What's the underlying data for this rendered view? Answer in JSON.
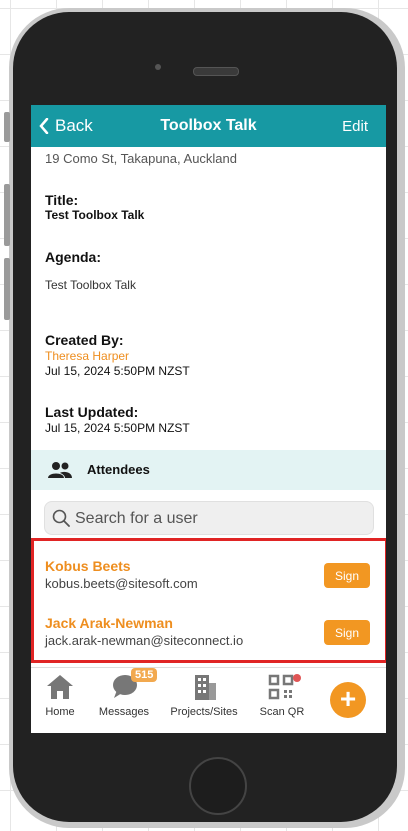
{
  "header": {
    "back_label": "Back",
    "title": "Toolbox Talk",
    "edit_label": "Edit"
  },
  "address": "19 Como St, Takapuna, Auckland",
  "details": {
    "title_label": "Title:",
    "title_value": "Test Toolbox Talk",
    "agenda_label": "Agenda:",
    "agenda_value": "Test Toolbox Talk",
    "created_label": "Created By:",
    "created_by": "Theresa Harper",
    "created_date": "Jul 15, 2024 5:50PM NZST",
    "updated_label": "Last Updated:",
    "updated_date": "Jul 15, 2024 5:50PM NZST"
  },
  "attendees": {
    "label": "Attendees",
    "search_placeholder": "Search for a user",
    "list": [
      {
        "name": "Kobus Beets",
        "email": "kobus.beets@sitesoft.com",
        "action": "Sign"
      },
      {
        "name": "Jack Arak-Newman",
        "email": "jack.arak-newman@siteconnect.io",
        "action": "Sign"
      }
    ]
  },
  "tabbar": {
    "home": "Home",
    "messages": "Messages",
    "messages_badge": "515",
    "projects": "Projects/Sites",
    "scan": "Scan QR",
    "add": "+"
  },
  "colors": {
    "header": "#1799a3",
    "accent": "#f29722",
    "highlight": "#e02424"
  }
}
